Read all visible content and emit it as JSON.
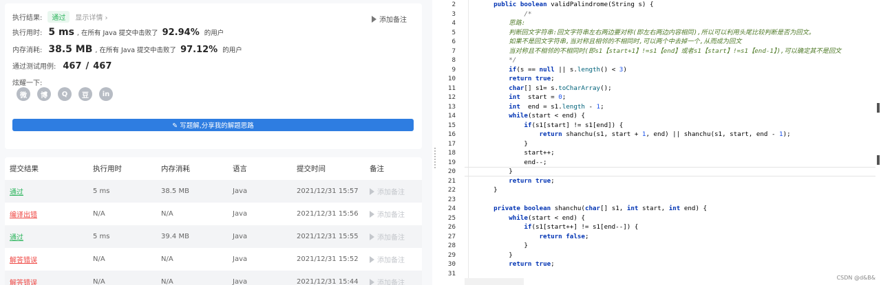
{
  "result": {
    "status_label": "执行结果:",
    "status_value": "通过",
    "details_link": "显示详情 ›",
    "add_note": "添加备注",
    "runtime_label": "执行用时:",
    "runtime_value": "5 ms",
    "runtime_text": ", 在所有 Java 提交中击败了",
    "runtime_pct": "92.94%",
    "runtime_suffix": "的用户",
    "memory_label": "内存消耗:",
    "memory_value": "38.5 MB",
    "memory_text": ", 在所有 Java 提交中击败了",
    "memory_pct": "97.12%",
    "memory_suffix": "的用户",
    "tests_label": "通过测试用例:",
    "tests_passed": "467",
    "tests_sep": "/",
    "tests_total": "467",
    "share_label": "炫耀一下:",
    "share_icons": [
      "微",
      "博",
      "Q",
      "豆",
      "in"
    ],
    "write_button": "✎ 写题解,分享我的解题思路"
  },
  "table": {
    "headers": [
      "提交结果",
      "执行用时",
      "内存消耗",
      "语言",
      "提交时间",
      "备注"
    ],
    "rows": [
      {
        "status": "通过",
        "time": "5 ms",
        "memory": "38.5 MB",
        "lang": "Java",
        "date": "2021/12/31 15:57",
        "note": "添加备注"
      },
      {
        "status": "编译出错",
        "time": "N/A",
        "memory": "N/A",
        "lang": "Java",
        "date": "2021/12/31 15:56",
        "note": "添加备注"
      },
      {
        "status": "通过",
        "time": "5 ms",
        "memory": "39.4 MB",
        "lang": "Java",
        "date": "2021/12/31 15:55",
        "note": "添加备注"
      },
      {
        "status": "解答错误",
        "time": "N/A",
        "memory": "N/A",
        "lang": "Java",
        "date": "2021/12/31 15:52",
        "note": "添加备注"
      },
      {
        "status": "解答错误",
        "time": "N/A",
        "memory": "N/A",
        "lang": "Java",
        "date": "2021/12/31 15:44",
        "note": "添加备注"
      }
    ]
  },
  "editor": {
    "lines": [
      {
        "n": "2",
        "t": "    public boolean validPalindrome(String s) {"
      },
      {
        "n": "3",
        "t": "            /*"
      },
      {
        "n": "4",
        "t": "        思路:"
      },
      {
        "n": "5",
        "t": "        判断回文字符串:回文字符串左右两边要对称(即左右两边内容相同),所以可以利用头尾比较判断是否为回文。"
      },
      {
        "n": "6",
        "t": "        如果不是回文字符串,当对称且相邻的不相同时,可以两个中去掉一个,从而成为回文"
      },
      {
        "n": "7",
        "t": "        当对称且不相邻的不相同时(即s1【start+1】!=s1【end】或者s1【start】!=s1【end-1】),可以确定其不是回文"
      },
      {
        "n": "8",
        "t": "        */"
      },
      {
        "n": "9",
        "t": "        if(s == null || s.length() < 3)"
      },
      {
        "n": "10",
        "t": "        return true;"
      },
      {
        "n": "11",
        "t": "        char[] s1= s.toCharArray();"
      },
      {
        "n": "12",
        "t": "        int  start = 0;"
      },
      {
        "n": "13",
        "t": "        int  end = s1.length - 1;"
      },
      {
        "n": "14",
        "t": "        while(start < end) {"
      },
      {
        "n": "15",
        "t": "            if(s1[start] != s1[end]) {"
      },
      {
        "n": "16",
        "t": "                return shanchu(s1, start + 1, end) || shanchu(s1, start, end - 1);"
      },
      {
        "n": "17",
        "t": "            }"
      },
      {
        "n": "18",
        "t": "            start++;"
      },
      {
        "n": "19",
        "t": "            end--;"
      },
      {
        "n": "20",
        "t": "        }"
      },
      {
        "n": "21",
        "t": "        return true;"
      },
      {
        "n": "22",
        "t": "    }"
      },
      {
        "n": "23",
        "t": ""
      },
      {
        "n": "24",
        "t": "    private boolean shanchu(char[] s1, int start, int end) {"
      },
      {
        "n": "25",
        "t": "        while(start < end) {"
      },
      {
        "n": "26",
        "t": "            if(s1[start++] != s1[end--]) {"
      },
      {
        "n": "27",
        "t": "                return false;"
      },
      {
        "n": "28",
        "t": "            }"
      },
      {
        "n": "29",
        "t": "        }"
      },
      {
        "n": "30",
        "t": "        return true;"
      },
      {
        "n": "31",
        "t": ""
      }
    ],
    "watermark": "CSDN @d&B&"
  }
}
